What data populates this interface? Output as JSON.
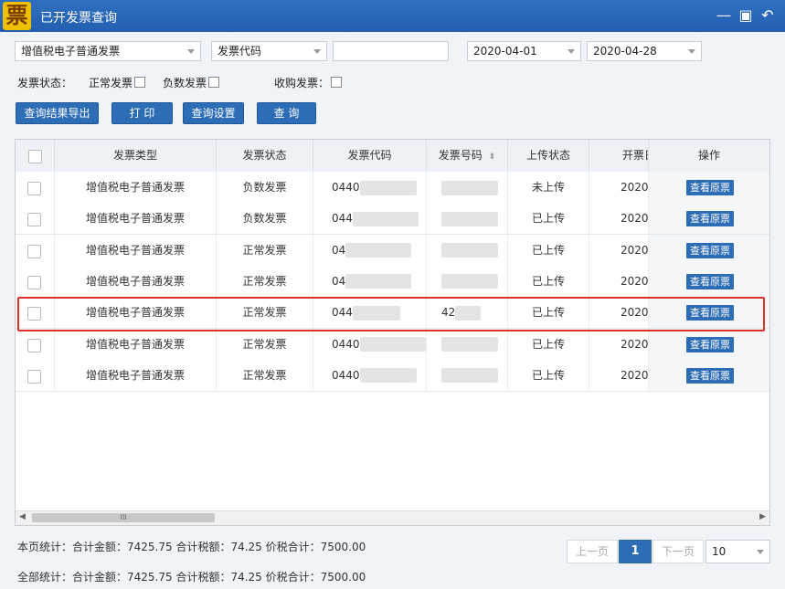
{
  "window": {
    "title": "已开发票查询",
    "logo_char": "票"
  },
  "filters": {
    "invoice_type": "增值税电子普通发票",
    "code_type": "发票代码",
    "code_value": "",
    "date_from": "2020-04-01",
    "date_to": "2020-04-28"
  },
  "status_filter": {
    "label": "发票状态：",
    "normal": "正常发票",
    "negative": "负数发票",
    "purchase": "收购发票："
  },
  "toolbar": {
    "export": "查询结果导出",
    "print": "打 印",
    "settings": "查询设置",
    "query": "查 询"
  },
  "table": {
    "columns": [
      "发票类型",
      "发票状态",
      "发票代码",
      "发票号码",
      "上传状态",
      "开票日",
      "操作"
    ],
    "rows": [
      {
        "type": "增值税电子普通发票",
        "status": "负数发票",
        "code": "0440",
        "number": "",
        "upload": "未上传",
        "date": "2020-",
        "action": "查看原票"
      },
      {
        "type": "增值税电子普通发票",
        "status": "负数发票",
        "code": "044",
        "number": "",
        "upload": "已上传",
        "date": "2020-",
        "action": "查看原票"
      },
      {
        "type": "增值税电子普通发票",
        "status": "正常发票",
        "code": "04",
        "number": "",
        "upload": "已上传",
        "date": "2020-",
        "action": "查看原票"
      },
      {
        "type": "增值税电子普通发票",
        "status": "正常发票",
        "code": "04",
        "number": "",
        "upload": "已上传",
        "date": "2020-",
        "action": "查看原票"
      },
      {
        "type": "增值税电子普通发票",
        "status": "正常发票",
        "code": "044",
        "number": "42",
        "upload": "已上传",
        "date": "2020-",
        "action": "查看原票"
      },
      {
        "type": "增值税电子普通发票",
        "status": "正常发票",
        "code": "0440",
        "number": "",
        "upload": "已上传",
        "date": "2020-",
        "action": "查看原票"
      },
      {
        "type": "增值税电子普通发票",
        "status": "正常发票",
        "code": "0440",
        "number": "",
        "upload": "已上传",
        "date": "2020-",
        "action": "查看原票"
      }
    ],
    "scrollbar_grip": "III"
  },
  "summary": {
    "page": "本页统计：合计金额：7425.75  合计税额：74.25   价税合计：7500.00",
    "all": "全部统计：合计金额：7425.75  合计税额：74.25   价税合计：7500.00"
  },
  "pager": {
    "prev": "上一页",
    "current": "1",
    "next": "下一页",
    "page_size": "10"
  },
  "colors": {
    "accent": "#2d6db5",
    "highlight": "#d9322b",
    "titlebar": "#2a66b6"
  }
}
